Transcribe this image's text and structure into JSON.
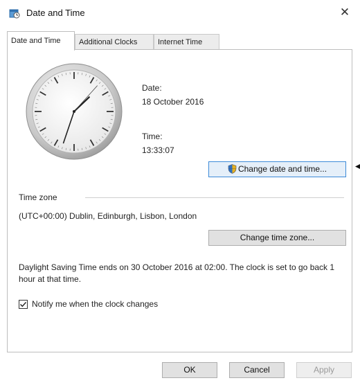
{
  "window": {
    "title": "Date and Time",
    "close_glyph": "✕",
    "title_icon": "date-time-icon"
  },
  "tabs": [
    {
      "label": "Date and Time",
      "active": true
    },
    {
      "label": "Additional Clocks",
      "active": false
    },
    {
      "label": "Internet Time",
      "active": false
    }
  ],
  "date_section": {
    "label": "Date:",
    "value": "18 October 2016"
  },
  "time_section": {
    "label": "Time:",
    "value": "13:33:07"
  },
  "clock": {
    "hours": 13,
    "minutes": 33,
    "seconds": 7
  },
  "buttons": {
    "change_date_time": "Change date and time...",
    "change_time_zone": "Change time zone...",
    "ok": "OK",
    "cancel": "Cancel",
    "apply": "Apply"
  },
  "timezone": {
    "heading": "Time zone",
    "value": "(UTC+00:00) Dublin, Edinburgh, Lisbon, London"
  },
  "dst_notice": "Daylight Saving Time ends on 30 October 2016 at 02:00. The clock is set to go back 1 hour at that time.",
  "notify_checkbox": {
    "label": "Notify me when the clock changes",
    "checked": true
  },
  "colors": {
    "accent_border": "#3c8ad8",
    "disabled_text": "#9a9a9a"
  }
}
